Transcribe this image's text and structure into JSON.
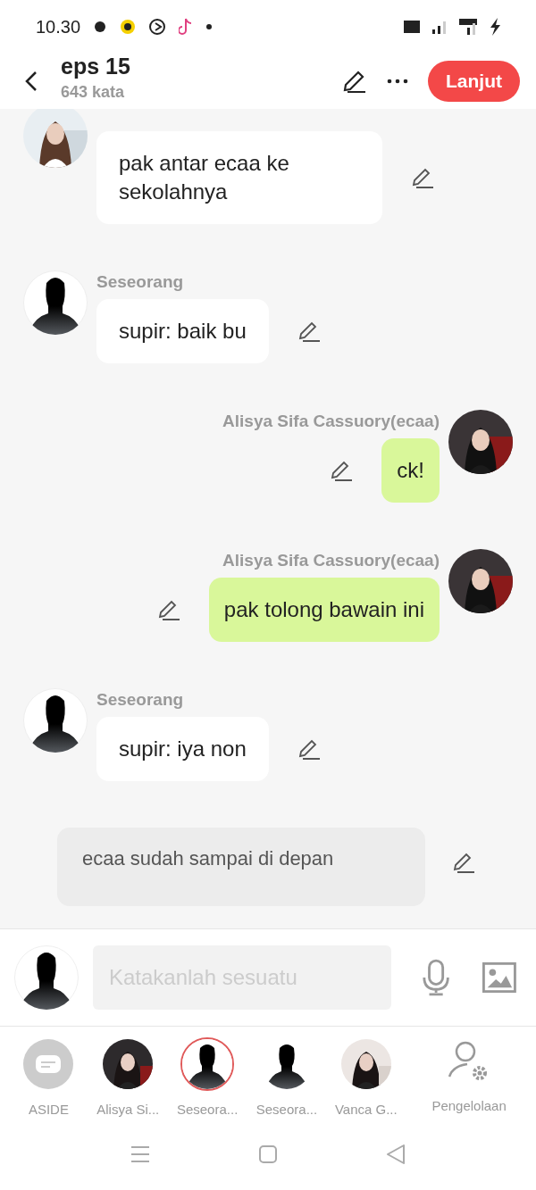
{
  "status_bar": {
    "time": "10.30"
  },
  "header": {
    "title": "eps 15",
    "subtitle": "643 kata",
    "action": "Lanjut"
  },
  "messages": [
    {
      "kind": "left",
      "photo": true,
      "text": "pak antar ecaa ke sekolahnya"
    },
    {
      "kind": "left",
      "photo": false,
      "name": "Seseorang",
      "text": "supir: baik bu"
    },
    {
      "kind": "right",
      "photo": true,
      "name": "Alisya Sifa Cassuory(ecaa)",
      "text": "ck!"
    },
    {
      "kind": "right",
      "photo": true,
      "name": "Alisya Sifa Cassuory(ecaa)",
      "text": "pak tolong bawain ini"
    },
    {
      "kind": "left",
      "photo": false,
      "name": "Seseorang",
      "text": "supir: iya non"
    },
    {
      "kind": "aside",
      "text": "ecaa sudah sampai di depan"
    }
  ],
  "composer": {
    "placeholder": "Katakanlah sesuatu"
  },
  "characters": [
    {
      "kind": "aside",
      "label": "ASIDE",
      "selected": false
    },
    {
      "label": "Alisya Si...",
      "selected": false
    },
    {
      "kind": "silhouette",
      "label": "Seseora...",
      "selected": true
    },
    {
      "kind": "silhouette",
      "label": "Seseora...",
      "selected": false
    },
    {
      "label": "Vanca G...",
      "selected": false
    }
  ],
  "manage": {
    "label": "Pengelolaan"
  }
}
